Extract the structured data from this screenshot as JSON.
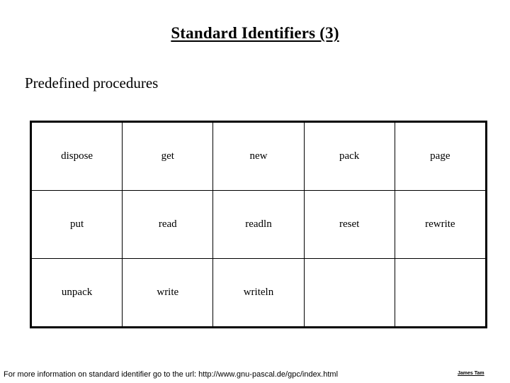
{
  "slide": {
    "title": "Standard Identifiers (3)",
    "subtitle": "Predefined procedures",
    "footer_note": "For more information on standard identifier go to the url: http://www.gnu-pascal.de/gpc/index.html",
    "footer_credit": "James Tam",
    "colors": {
      "background": "#ffffff",
      "text": "#000000",
      "table_border": "#000000"
    }
  },
  "table": {
    "columns": 5,
    "rows": [
      [
        "dispose",
        "get",
        "new",
        "pack",
        "page"
      ],
      [
        "put",
        "read",
        "readln",
        "reset",
        "rewrite"
      ],
      [
        "unpack",
        "write",
        "writeln",
        "",
        ""
      ]
    ]
  }
}
